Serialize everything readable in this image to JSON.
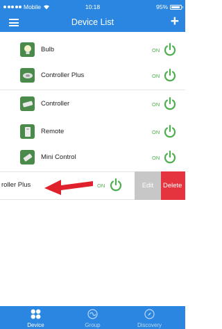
{
  "status_bar": {
    "carrier": "Mobile",
    "time": "10:18",
    "battery": "95%"
  },
  "nav": {
    "title": "Device List",
    "add_label": "+"
  },
  "devices": [
    {
      "name": "Bulb",
      "state": "ON",
      "icon": "bulb-icon"
    },
    {
      "name": "Controller Plus",
      "state": "ON",
      "icon": "controller-plus-icon"
    },
    {
      "name": "Controller",
      "state": "ON",
      "icon": "controller-icon"
    },
    {
      "name": "Remote",
      "state": "ON",
      "icon": "remote-icon"
    },
    {
      "name": "Mini Control",
      "state": "ON",
      "icon": "mini-control-icon"
    }
  ],
  "swiped_row": {
    "name": "roller Plus",
    "state": "ON",
    "edit_label": "Edit",
    "delete_label": "Delete"
  },
  "tabs": [
    {
      "label": "Device",
      "icon": "grid-icon",
      "active": true
    },
    {
      "label": "Group",
      "icon": "group-icon",
      "active": false
    },
    {
      "label": "Discovery",
      "icon": "compass-icon",
      "active": false
    }
  ],
  "colors": {
    "bar": "#2a86e0",
    "on": "#4cae4c",
    "delete": "#e5343e",
    "edit": "#c7c7c7",
    "arrow": "#e0202a"
  }
}
